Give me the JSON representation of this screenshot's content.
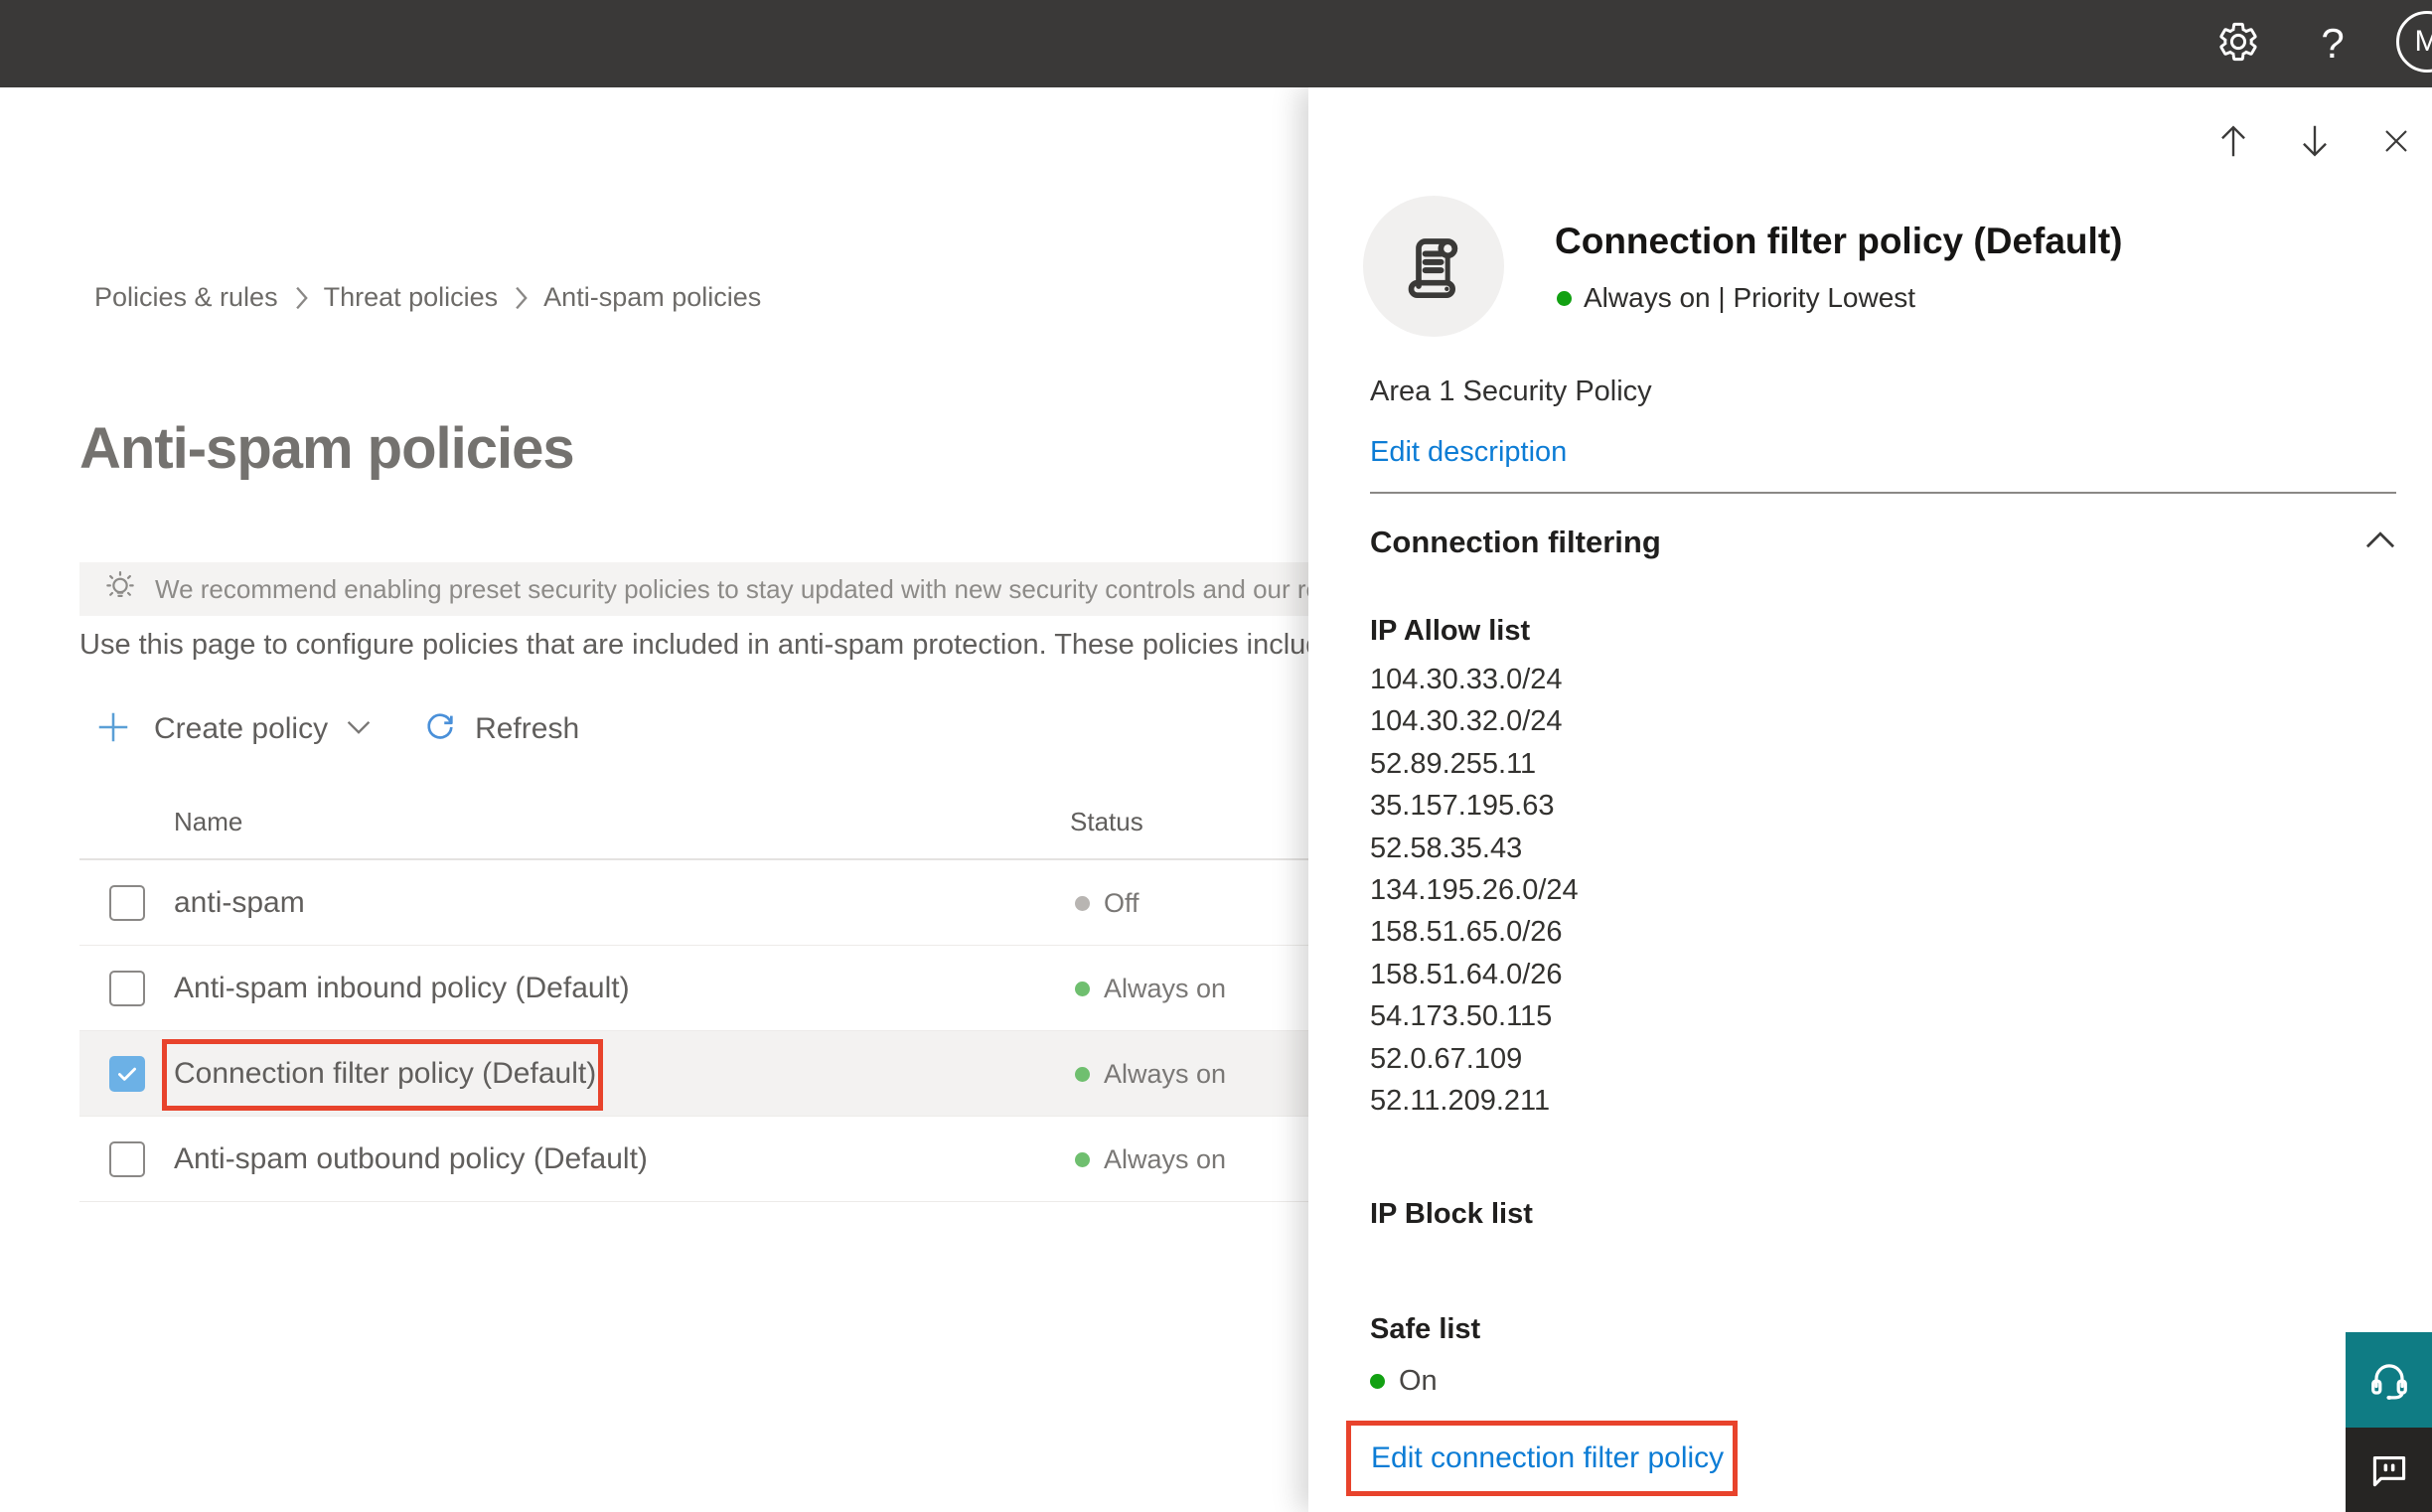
{
  "topbar": {
    "help_label": "?",
    "avatar_initial": "M"
  },
  "breadcrumb": {
    "items": [
      "Policies & rules",
      "Threat policies",
      "Anti-spam policies"
    ]
  },
  "page": {
    "title": "Anti-spam policies",
    "banner_text": "We recommend enabling preset security policies to stay updated with new security controls and our recomme",
    "description": "Use this page to configure policies that are included in anti-spam protection. These policies include"
  },
  "toolbar": {
    "create_label": "Create policy",
    "refresh_label": "Refresh"
  },
  "table": {
    "columns": [
      "Name",
      "Status"
    ],
    "rows": [
      {
        "name": "anti-spam",
        "status": "Off",
        "checked": false,
        "selected": false
      },
      {
        "name": "Anti-spam inbound policy (Default)",
        "status": "Always on",
        "checked": false,
        "selected": false
      },
      {
        "name": "Connection filter policy (Default)",
        "status": "Always on",
        "checked": true,
        "selected": true
      },
      {
        "name": "Anti-spam outbound policy (Default)",
        "status": "Always on",
        "checked": false,
        "selected": false
      }
    ]
  },
  "panel": {
    "title": "Connection filter policy (Default)",
    "status": "Always on | Priority Lowest",
    "description": "Area 1 Security Policy",
    "edit_description_label": "Edit description",
    "section_label": "Connection filtering",
    "ip_allow": {
      "label": "IP Allow list",
      "items": [
        "104.30.33.0/24",
        "104.30.32.0/24",
        "52.89.255.11",
        "35.157.195.63",
        "52.58.35.43",
        "134.195.26.0/24",
        "158.51.65.0/26",
        "158.51.64.0/26",
        "54.173.50.115",
        "52.0.67.109",
        "52.11.209.211"
      ]
    },
    "ip_block_label": "IP Block list",
    "safe_list": {
      "label": "Safe list",
      "value": "On"
    },
    "edit_link_label": "Edit connection filter policy"
  },
  "colors": {
    "topbar_bg": "#3A3938",
    "accent_blue_link": "#0C7CD5",
    "selection_red_outline": "#E8432C",
    "checkbox_checked_blue": "#6CB1E6",
    "status_green_table": "#6FBF6F",
    "status_green_panel": "#12A112",
    "status_gray_off": "#B8B5B2",
    "support_teal": "#0F7C84",
    "feedback_dark": "#262523"
  }
}
